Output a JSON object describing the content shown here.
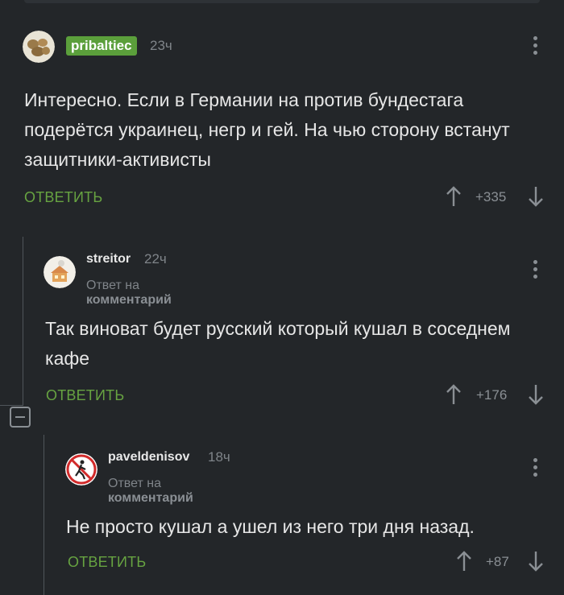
{
  "comments": [
    {
      "username": "pribaltiec",
      "time": "23ч",
      "text": "Интересно. Если в Германии на против бундестага подерётся украинец, негр и гей. На чью сторону встанут защитники-активисты",
      "reply_label": "ОТВЕТИТЬ",
      "votes": "+335"
    },
    {
      "username": "streitor",
      "time": "22ч",
      "reply_prefix": "Ответ на",
      "reply_target": "комментарий",
      "text": "Так виноват будет русский который кушал в соседнем кафе",
      "reply_label": "ОТВЕТИТЬ",
      "votes": "+176"
    },
    {
      "username": "paveldenisov",
      "time": "18ч",
      "reply_prefix": "Ответ на",
      "reply_target": "комментарий",
      "text": "Не просто кушал а ушел из него три дня назад.",
      "reply_label": "ОТВЕТИТЬ",
      "votes": "+87"
    }
  ],
  "colors": {
    "background": "#232629",
    "accent_green": "#67a341",
    "badge_green": "#5b9f3b",
    "muted": "#8a8f94"
  },
  "icons": [
    "kebab-menu-icon",
    "upvote-arrow-icon",
    "downvote-arrow-icon",
    "collapse-thread-icon"
  ]
}
